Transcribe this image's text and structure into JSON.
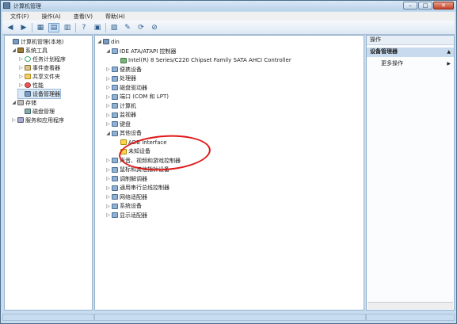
{
  "window": {
    "title": "计算机管理",
    "min_label": "–",
    "max_label": "□",
    "close_label": "✕"
  },
  "menu": [
    "文件(F)",
    "操作(A)",
    "查看(V)",
    "帮助(H)"
  ],
  "toolbar_glyphs": [
    "◀",
    "▶",
    "▦",
    "▤",
    "▥",
    "?",
    "▣",
    "▧",
    "✎",
    "⟳",
    "⊘"
  ],
  "left_tree": [
    {
      "label": "计算机管理(本地)",
      "icon": "computer-icon",
      "twisty": ""
    },
    {
      "label": "系统工具",
      "icon": "tools-icon",
      "twisty": "◢"
    },
    {
      "label": "任务计划程序",
      "icon": "clock-icon",
      "twisty": "▷"
    },
    {
      "label": "事件查看器",
      "icon": "event-log-icon",
      "twisty": "▷"
    },
    {
      "label": "共享文件夹",
      "icon": "folder-icon",
      "twisty": "▷"
    },
    {
      "label": "性能",
      "icon": "performance-icon",
      "twisty": "▷"
    },
    {
      "label": "设备管理器",
      "icon": "device-manager-icon",
      "twisty": ""
    },
    {
      "label": "存储",
      "icon": "storage-icon",
      "twisty": "◢"
    },
    {
      "label": "磁盘管理",
      "icon": "disk-icon",
      "twisty": ""
    },
    {
      "label": "服务和应用程序",
      "icon": "services-icon",
      "twisty": "▷"
    }
  ],
  "device_tree": {
    "root": "din",
    "items": [
      {
        "label": "IDE ATA/ATAPI 控制器",
        "twisty": "◢",
        "indent": 1,
        "icon": "ide-controller-icon"
      },
      {
        "label": "Intel(R) 8 Series/C220 Chipset Family SATA AHCI Controller",
        "twisty": "",
        "indent": 2,
        "icon": "chip-icon"
      },
      {
        "label": "便携设备",
        "twisty": "▷",
        "indent": 1,
        "icon": "portable-device-icon"
      },
      {
        "label": "处理器",
        "twisty": "▷",
        "indent": 1,
        "icon": "processor-icon"
      },
      {
        "label": "磁盘驱动器",
        "twisty": "▷",
        "indent": 1,
        "icon": "disk-drive-icon"
      },
      {
        "label": "端口 (COM 和 LPT)",
        "twisty": "▷",
        "indent": 1,
        "icon": "port-icon"
      },
      {
        "label": "计算机",
        "twisty": "▷",
        "indent": 1,
        "icon": "computer-icon"
      },
      {
        "label": "监视器",
        "twisty": "▷",
        "indent": 1,
        "icon": "monitor-icon"
      },
      {
        "label": "键盘",
        "twisty": "▷",
        "indent": 1,
        "icon": "keyboard-icon"
      },
      {
        "label": "其他设备",
        "twisty": "◢",
        "indent": 1,
        "icon": "other-devices-icon"
      },
      {
        "label": "ADB Interface",
        "twisty": "",
        "indent": 2,
        "icon": "warning-device-icon"
      },
      {
        "label": "未知设备",
        "twisty": "",
        "indent": 2,
        "icon": "warning-device-icon"
      },
      {
        "label": "声音、视频和游戏控制器",
        "twisty": "▷",
        "indent": 1,
        "icon": "sound-icon"
      },
      {
        "label": "鼠标和其他指针设备",
        "twisty": "▷",
        "indent": 1,
        "icon": "mouse-icon"
      },
      {
        "label": "调制解调器",
        "twisty": "▷",
        "indent": 1,
        "icon": "modem-icon"
      },
      {
        "label": "通用串行总线控制器",
        "twisty": "▷",
        "indent": 1,
        "icon": "usb-icon"
      },
      {
        "label": "网络适配器",
        "twisty": "▷",
        "indent": 1,
        "icon": "network-adapter-icon"
      },
      {
        "label": "系统设备",
        "twisty": "▷",
        "indent": 1,
        "icon": "system-device-icon"
      },
      {
        "label": "显示适配器",
        "twisty": "▷",
        "indent": 1,
        "icon": "display-adapter-icon"
      }
    ]
  },
  "actions": {
    "header": "操作",
    "section": "设备管理器",
    "section_arrow": "▲",
    "more": "更多操作",
    "more_arrow": "▶"
  },
  "colors": {
    "annotation": "#e01818",
    "selection": "#d9e8f7"
  }
}
